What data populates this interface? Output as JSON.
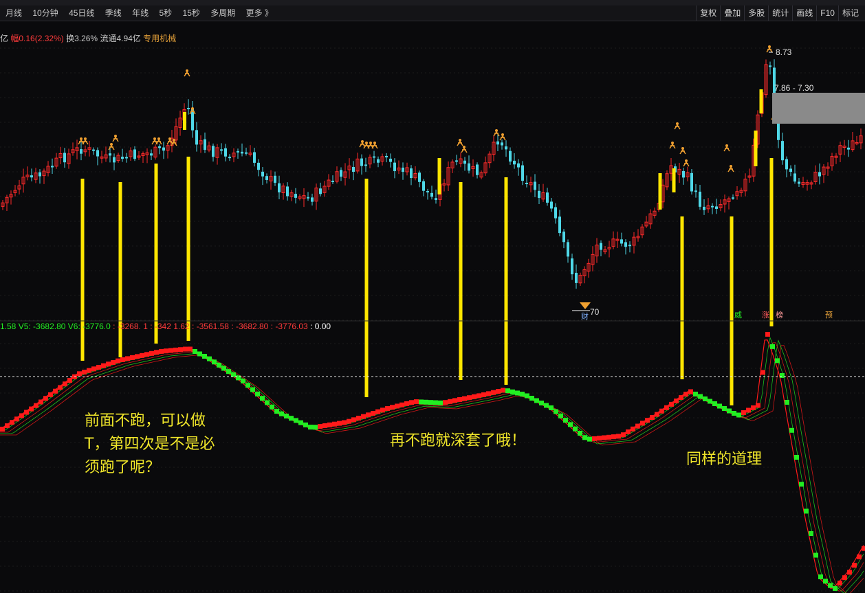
{
  "toolbar": {
    "left": [
      "月线",
      "10分钟",
      "45日线",
      "季线",
      "年线",
      "5秒",
      "15秒",
      "多周期",
      "更多 》"
    ],
    "right": [
      "复权",
      "叠加",
      "多股",
      "统计",
      "画线",
      "F10",
      "标记"
    ]
  },
  "info": {
    "prefix": "亿",
    "change": "幅0.16(2.32%)",
    "turnover": "换3.26%",
    "float_cap": "流通4.94亿",
    "industry": "专用机械"
  },
  "indicator": {
    "seg1": "1.58",
    "v5": "V5: -3682.80",
    "v6": "V6: -3776.0",
    "vals": ": -3268.",
    "s2": "1 : -342",
    "s3": "1.62 : -3561.58 : -3682.80 : -3776.03",
    "last": ": 0.00"
  },
  "price_labels": {
    "high": "8.73",
    "range": "7.86 - 7.30",
    "low": "70"
  },
  "badges": {
    "cai": "财",
    "a": "威",
    "b": "涨",
    "c": "榜",
    "d": "预"
  },
  "annotations": {
    "a1": [
      "前面不跑，可以做",
      "T，第四次是不是必",
      "须跑了呢？"
    ],
    "a2": "再不跑就深套了哦！",
    "a3": "同样的道理"
  },
  "colors": {
    "up": "#ff2a2a",
    "down": "#4fd8e8",
    "signal": "#ffe600",
    "macd_up": "#ff1a1a",
    "macd_down": "#22ee22"
  }
}
